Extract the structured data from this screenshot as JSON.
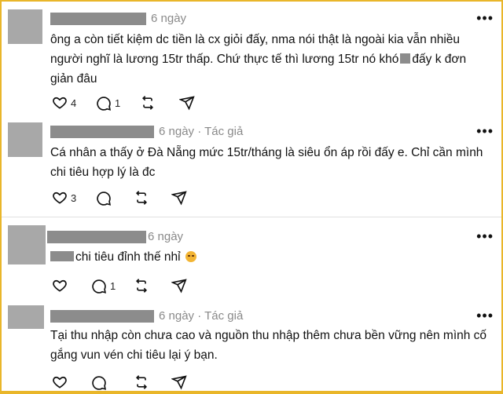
{
  "posts": [
    {
      "time": "6 ngày",
      "author_tag": "",
      "text_lines": [
        "ông a còn tiết kiệm dc tiền là cx giỏi đấy, nma nói thật là ngoài kia vẫn nhiều",
        "người nghĩ là lương 15tr thấp. Chứ thực tế thì lương 15tr nó khó",
        "đấy k đơn",
        "giản đâu"
      ],
      "likes": "4",
      "replies": "1"
    },
    {
      "time": "6 ngày",
      "author_tag": "· Tác giả",
      "text_lines": [
        "Cá nhân a thấy ở Đà Nẵng mức 15tr/tháng là siêu ổn áp rồi đấy e. Chỉ cần mình",
        "chi tiêu hợp lý là đc"
      ],
      "likes": "3",
      "replies": ""
    },
    {
      "time": "6 ngày",
      "author_tag": "",
      "text_lines": [
        "chi tiêu đỉnh thế nhỉ"
      ],
      "likes": "",
      "replies": "1"
    },
    {
      "time": "6 ngày",
      "author_tag": "· Tác giả",
      "text_lines": [
        "Tại thu nhập còn chưa cao và nguồn thu nhập thêm chưa bền vững nên mình cố",
        "gắng vun vén chi tiêu lại ý bạn."
      ],
      "likes": "",
      "replies": ""
    }
  ],
  "more_icon": "more-horizontal-icon",
  "icons": {
    "like": "heart-icon",
    "reply": "comment-icon",
    "repost": "repost-icon",
    "share": "send-icon"
  }
}
